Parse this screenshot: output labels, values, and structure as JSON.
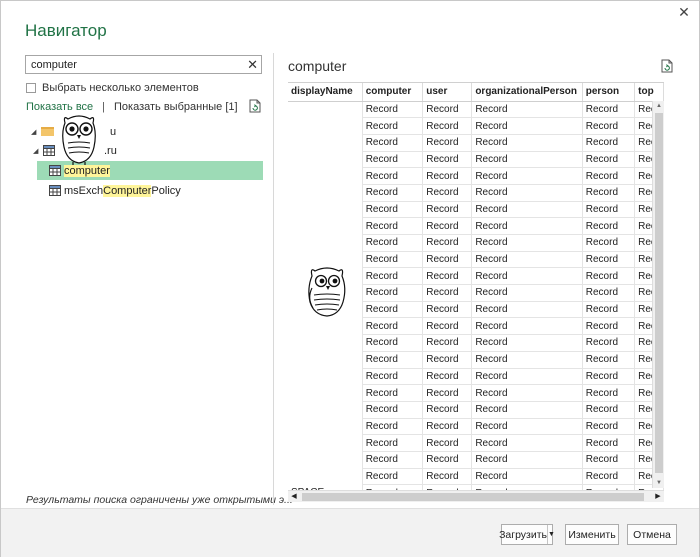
{
  "window": {
    "title": "Навигатор",
    "close_icon": "close-icon"
  },
  "left": {
    "search": {
      "value": "computer",
      "placeholder": ""
    },
    "select_multiple_label": "Выбрать несколько элементов",
    "show_all_label": "Показать все",
    "separator": "|",
    "show_selected_label": "Показать выбранные [1]",
    "tree": [
      {
        "label": "u",
        "type": "folder",
        "expanded": true
      },
      {
        "label": ".ru",
        "type": "table",
        "expanded": true
      },
      {
        "label_before": "",
        "label_highlight": "computer",
        "label_after": "",
        "type": "table",
        "selected": true
      },
      {
        "label_before": "msExch",
        "label_highlight": "Computer",
        "label_after": "Policy",
        "type": "table",
        "selected": false
      }
    ],
    "footer_note": "Результаты поиска ограничены уже открытыми э..."
  },
  "right": {
    "preview_title": "computer",
    "columns": [
      "displayName",
      "computer",
      "user",
      "organizationalPerson",
      "person",
      "top"
    ],
    "row_value": "Record",
    "top_value": "Rec",
    "row_count": 23,
    "partial_row_label": "SPACE..."
  },
  "buttons": {
    "load_label": "Загрузить",
    "edit_label": "Изменить",
    "cancel_label": "Отмена"
  },
  "colors": {
    "accent": "#217346",
    "selection": "#9ddbb6",
    "highlight": "#fff59a"
  }
}
